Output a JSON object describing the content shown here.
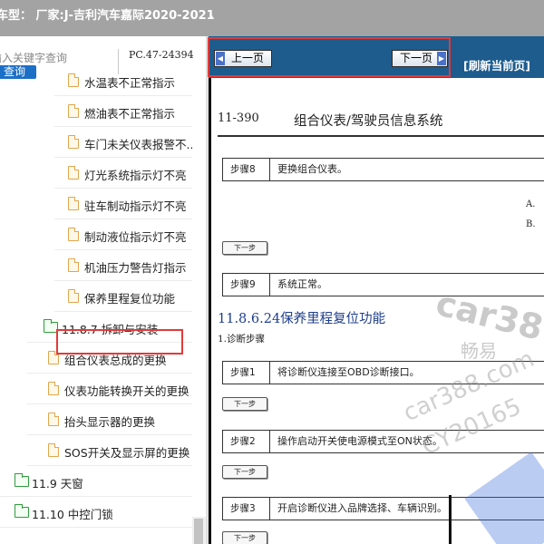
{
  "topbar": {
    "model_text": "车型： 厂家:J-吉利汽车嘉际2020-2021",
    "dot": "."
  },
  "left_panel": {
    "search_placeholder": "输入关键字查询",
    "search_button": "查询",
    "pc_code": "PC.47-24394",
    "tree_items": [
      {
        "label": "水温表不正常指示",
        "kind": "doc"
      },
      {
        "label": "燃油表不正常指示",
        "kind": "doc"
      },
      {
        "label": "车门未关仪表报警不...",
        "kind": "doc"
      },
      {
        "label": "灯光系统指示灯不亮",
        "kind": "doc"
      },
      {
        "label": "驻车制动指示灯不亮",
        "kind": "doc"
      },
      {
        "label": "制动液位指示灯不亮",
        "kind": "doc"
      },
      {
        "label": "机油压力警告灯指示",
        "kind": "doc"
      },
      {
        "label": "保养里程复位功能",
        "kind": "doc",
        "highlighted": true
      },
      {
        "label": "11.8.7 拆卸与安装",
        "kind": "folder"
      },
      {
        "label": "组合仪表总成的更换",
        "kind": "doc"
      },
      {
        "label": "仪表功能转换开关的更换",
        "kind": "doc"
      },
      {
        "label": "抬头显示器的更换",
        "kind": "doc"
      },
      {
        "label": "SOS开关及显示屏的更换",
        "kind": "doc"
      },
      {
        "label": "11.9 天窗",
        "kind": "folder"
      },
      {
        "label": "11.10 中控门锁",
        "kind": "folder"
      }
    ]
  },
  "nav": {
    "prev_label": "上一页",
    "next_label": "下一页",
    "refresh_label": "[刷新当前页]"
  },
  "document": {
    "page_number": "11-390",
    "section_title": "组合仪表/驾驶员信息系统",
    "steps_top": [
      {
        "step": "步骤8",
        "text": "更换组合仪表。"
      },
      {
        "step": "步骤9",
        "text": "系统正常。"
      }
    ],
    "choices": [
      "A.",
      "B."
    ],
    "next_step_label": "下一步",
    "subsection_title": "11.8.6.24保养里程复位功能",
    "diag_steps_heading": "1.诊断步骤",
    "steps_bottom": [
      {
        "step": "步骤1",
        "text": "将诊断仪连接至OBD诊断接口。"
      },
      {
        "step": "步骤2",
        "text": "操作启动开关使电源模式至ON状态。"
      },
      {
        "step": "步骤3",
        "text": "开启诊断仪进入品牌选择、车辆识别。"
      }
    ]
  },
  "watermark": {
    "site": "car388.com",
    "site_short": "car38",
    "cn": "畅易",
    "code": "CY20165"
  },
  "colors": {
    "topbar_bg": "#a3a3a3",
    "nav_bg": "#1e5c8e",
    "search_button_bg": "#1c6fc7",
    "highlight_border": "#e23a3a",
    "folder_icon": "#2f9c3c",
    "doc_icon": "#e0a64e",
    "subsection_title": "#1f3e8c"
  },
  "icons": [
    "document-icon",
    "folder-icon",
    "arrow-left-icon",
    "arrow-right-icon"
  ]
}
